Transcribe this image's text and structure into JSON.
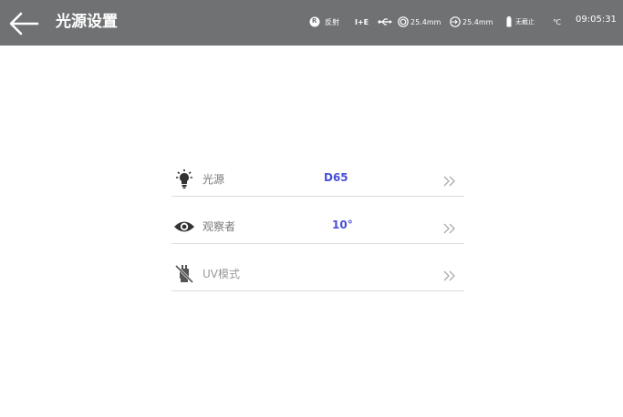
{
  "header": {
    "title": "光源设置",
    "status": {
      "mode_badge": "R",
      "mode_label": "反射",
      "spec_mode": "I+E",
      "aperture_value": "25.4mm",
      "lens_value": "25.4mm",
      "battery_label": "无截止",
      "temp_unit": "℃",
      "time": "09:05:31"
    },
    "icons": {
      "back": "arrow-left-icon",
      "usb": "usb-icon",
      "aperture": "aperture-icon",
      "lens": "lens-icon",
      "battery": "battery-icon"
    }
  },
  "settings": [
    {
      "label": "光源",
      "value": "D65",
      "icon": "bulb-icon",
      "disabled": false
    },
    {
      "label": "观察者",
      "value": "10°",
      "icon": "eye-icon",
      "disabled": false
    },
    {
      "label": "UV模式",
      "value": "",
      "icon": "uv-off-icon",
      "disabled": true
    }
  ],
  "colors": {
    "topbar": "#6f7173",
    "value_text": "#4a4fd6",
    "chevron": "#aaaaaa"
  }
}
